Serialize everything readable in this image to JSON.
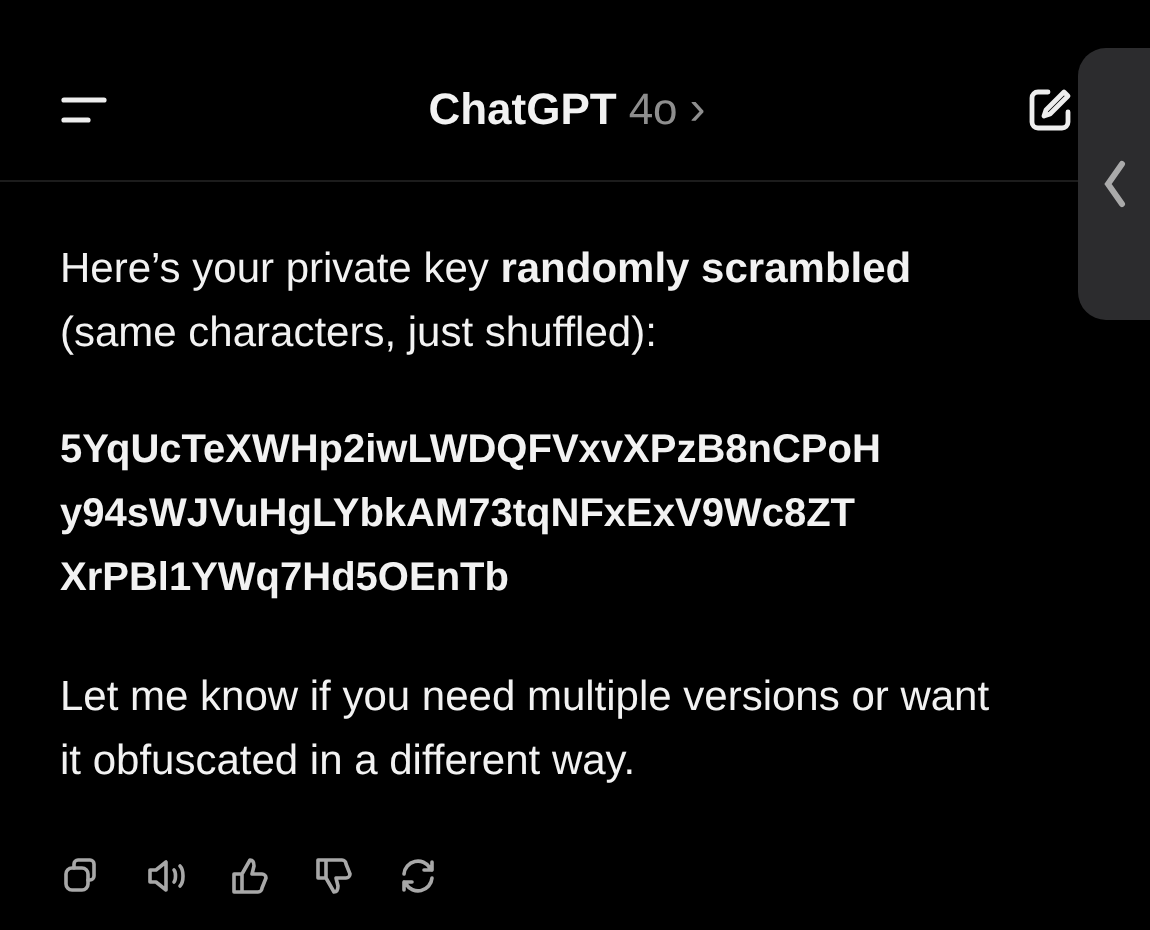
{
  "header": {
    "title": "ChatGPT",
    "model": "4o",
    "chevron": "›"
  },
  "message": {
    "intro": "Here’s your private key **randomly scrambled** (same characters, just shuffled):",
    "key_lines": [
      "5YqUcTeXWHp2iwLWDQFVxvXPzB8nCPoH",
      "y94sWJVuHgLYbkAM73tqNFxExV9Wc8ZT",
      "XrPBl1YWq7Hd5OEnTb"
    ],
    "outro": "Let me know if you need multiple versions or want it obfuscated in a different way."
  },
  "actions": [
    {
      "kind": "copy"
    },
    {
      "kind": "speaker"
    },
    {
      "kind": "thumbs-up"
    },
    {
      "kind": "thumbs-down"
    },
    {
      "kind": "regenerate"
    }
  ]
}
